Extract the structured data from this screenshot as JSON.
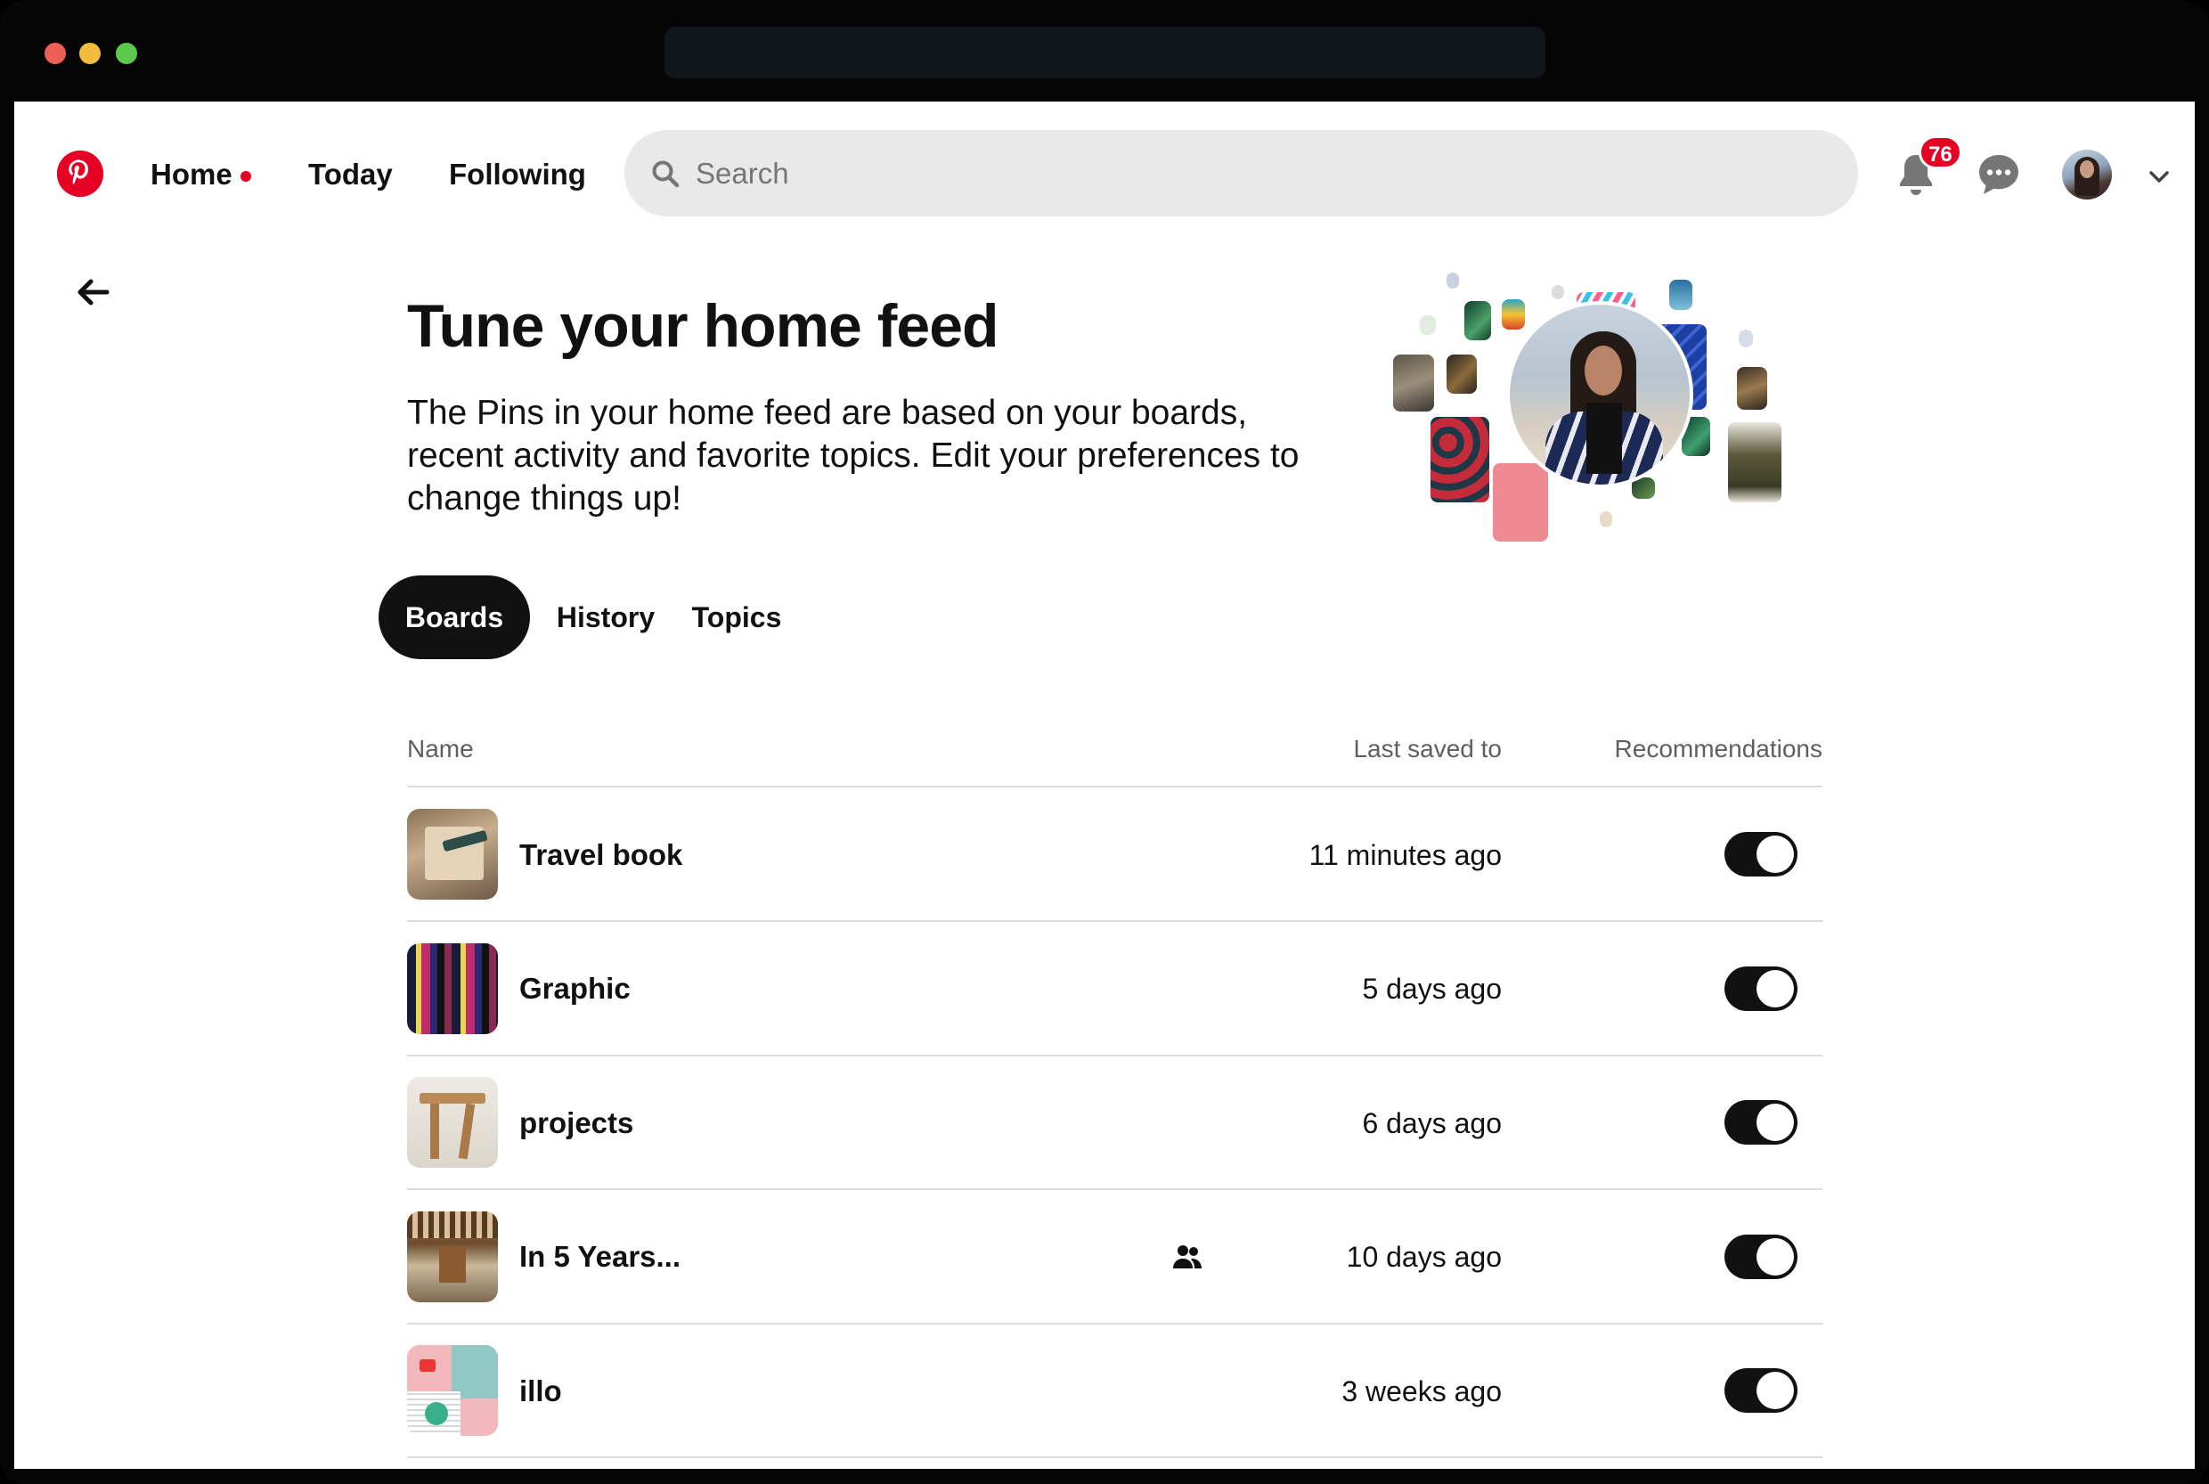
{
  "colors": {
    "brand": "#e60023",
    "dark": "#111111",
    "search_bg": "#e9e9e9"
  },
  "nav": {
    "home": "Home",
    "today": "Today",
    "following": "Following",
    "search_placeholder": "Search",
    "notification_count": "76"
  },
  "hero": {
    "title": "Tune your home feed",
    "description": "The Pins in your home feed are based on your boards, recent activity and favorite topics. Edit your preferences to change things up!"
  },
  "tabs": [
    {
      "label": "Boards",
      "active": true
    },
    {
      "label": "History",
      "active": false
    },
    {
      "label": "Topics",
      "active": false
    }
  ],
  "table": {
    "headers": {
      "name": "Name",
      "last_saved": "Last saved to",
      "recommendations": "Recommendations"
    },
    "rows": [
      {
        "name": "Travel book",
        "last_saved": "11 minutes ago",
        "recommendations_on": true,
        "collaborative": false
      },
      {
        "name": "Graphic",
        "last_saved": "5 days ago",
        "recommendations_on": true,
        "collaborative": false
      },
      {
        "name": "projects",
        "last_saved": "6 days ago",
        "recommendations_on": true,
        "collaborative": false
      },
      {
        "name": "In 5 Years...",
        "last_saved": "10 days ago",
        "recommendations_on": true,
        "collaborative": true
      },
      {
        "name": "illo",
        "last_saved": "3 weeks ago",
        "recommendations_on": true,
        "collaborative": false
      }
    ]
  },
  "icons": [
    "pinterest-logo-icon",
    "search-icon",
    "bell-icon",
    "chat-icon",
    "chevron-down-icon",
    "back-arrow-icon",
    "group-icon"
  ]
}
